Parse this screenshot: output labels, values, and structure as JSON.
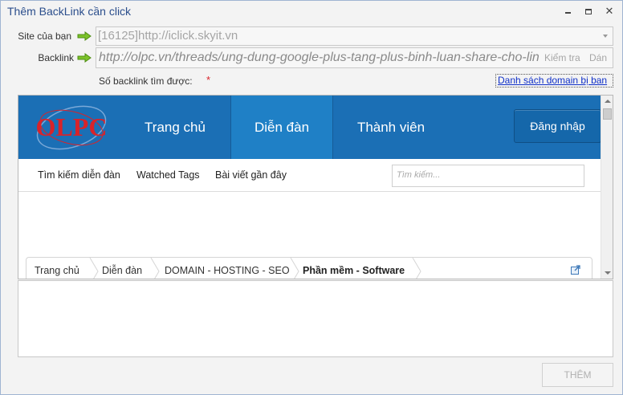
{
  "window": {
    "title": "Thêm BackLink cần click",
    "controls": {
      "close": "✕"
    }
  },
  "form": {
    "site_label": "Site của bạn",
    "site_value": "[16125]http://iclick.skyit.vn",
    "backlink_label": "Backlink",
    "backlink_value": "http://olpc.vn/threads/ung-dung-google-plus-tang-plus-binh-luan-share-cho-lin",
    "check_label": "Kiểm tra",
    "paste_label": "Dán",
    "count_label": "Số backlink tìm được:",
    "required_mark": "*",
    "domain_list_link": "Danh sách domain bị ban"
  },
  "browser": {
    "site": {
      "logo_text": "OLPC",
      "nav": {
        "home": "Trang chủ",
        "forum": "Diễn đàn",
        "members": "Thành viên",
        "login": "Đăng nhập"
      },
      "subnav": {
        "search_forums": "Tìm kiếm diễn đàn",
        "watched_tags": "Watched Tags",
        "recent_posts": "Bài viết gần đây"
      },
      "search_placeholder": "Tìm kiếm...",
      "breadcrumb": [
        "Trang chủ",
        "Diễn đàn",
        "DOMAIN - HOSTING - SEO",
        "Phần mềm - Software"
      ]
    }
  },
  "footer": {
    "add_button": "THÊM"
  },
  "colors": {
    "nav_bg": "#1b6fb5",
    "nav_active": "#1f80c6",
    "logo_red": "#d8232a",
    "link_blue": "#1030c8",
    "arrow_green": "#7cc22a"
  },
  "icons": [
    "green-arrow-icon",
    "dropdown-arrow-icon",
    "external-link-icon",
    "scroll-up-icon",
    "scroll-down-icon"
  ]
}
